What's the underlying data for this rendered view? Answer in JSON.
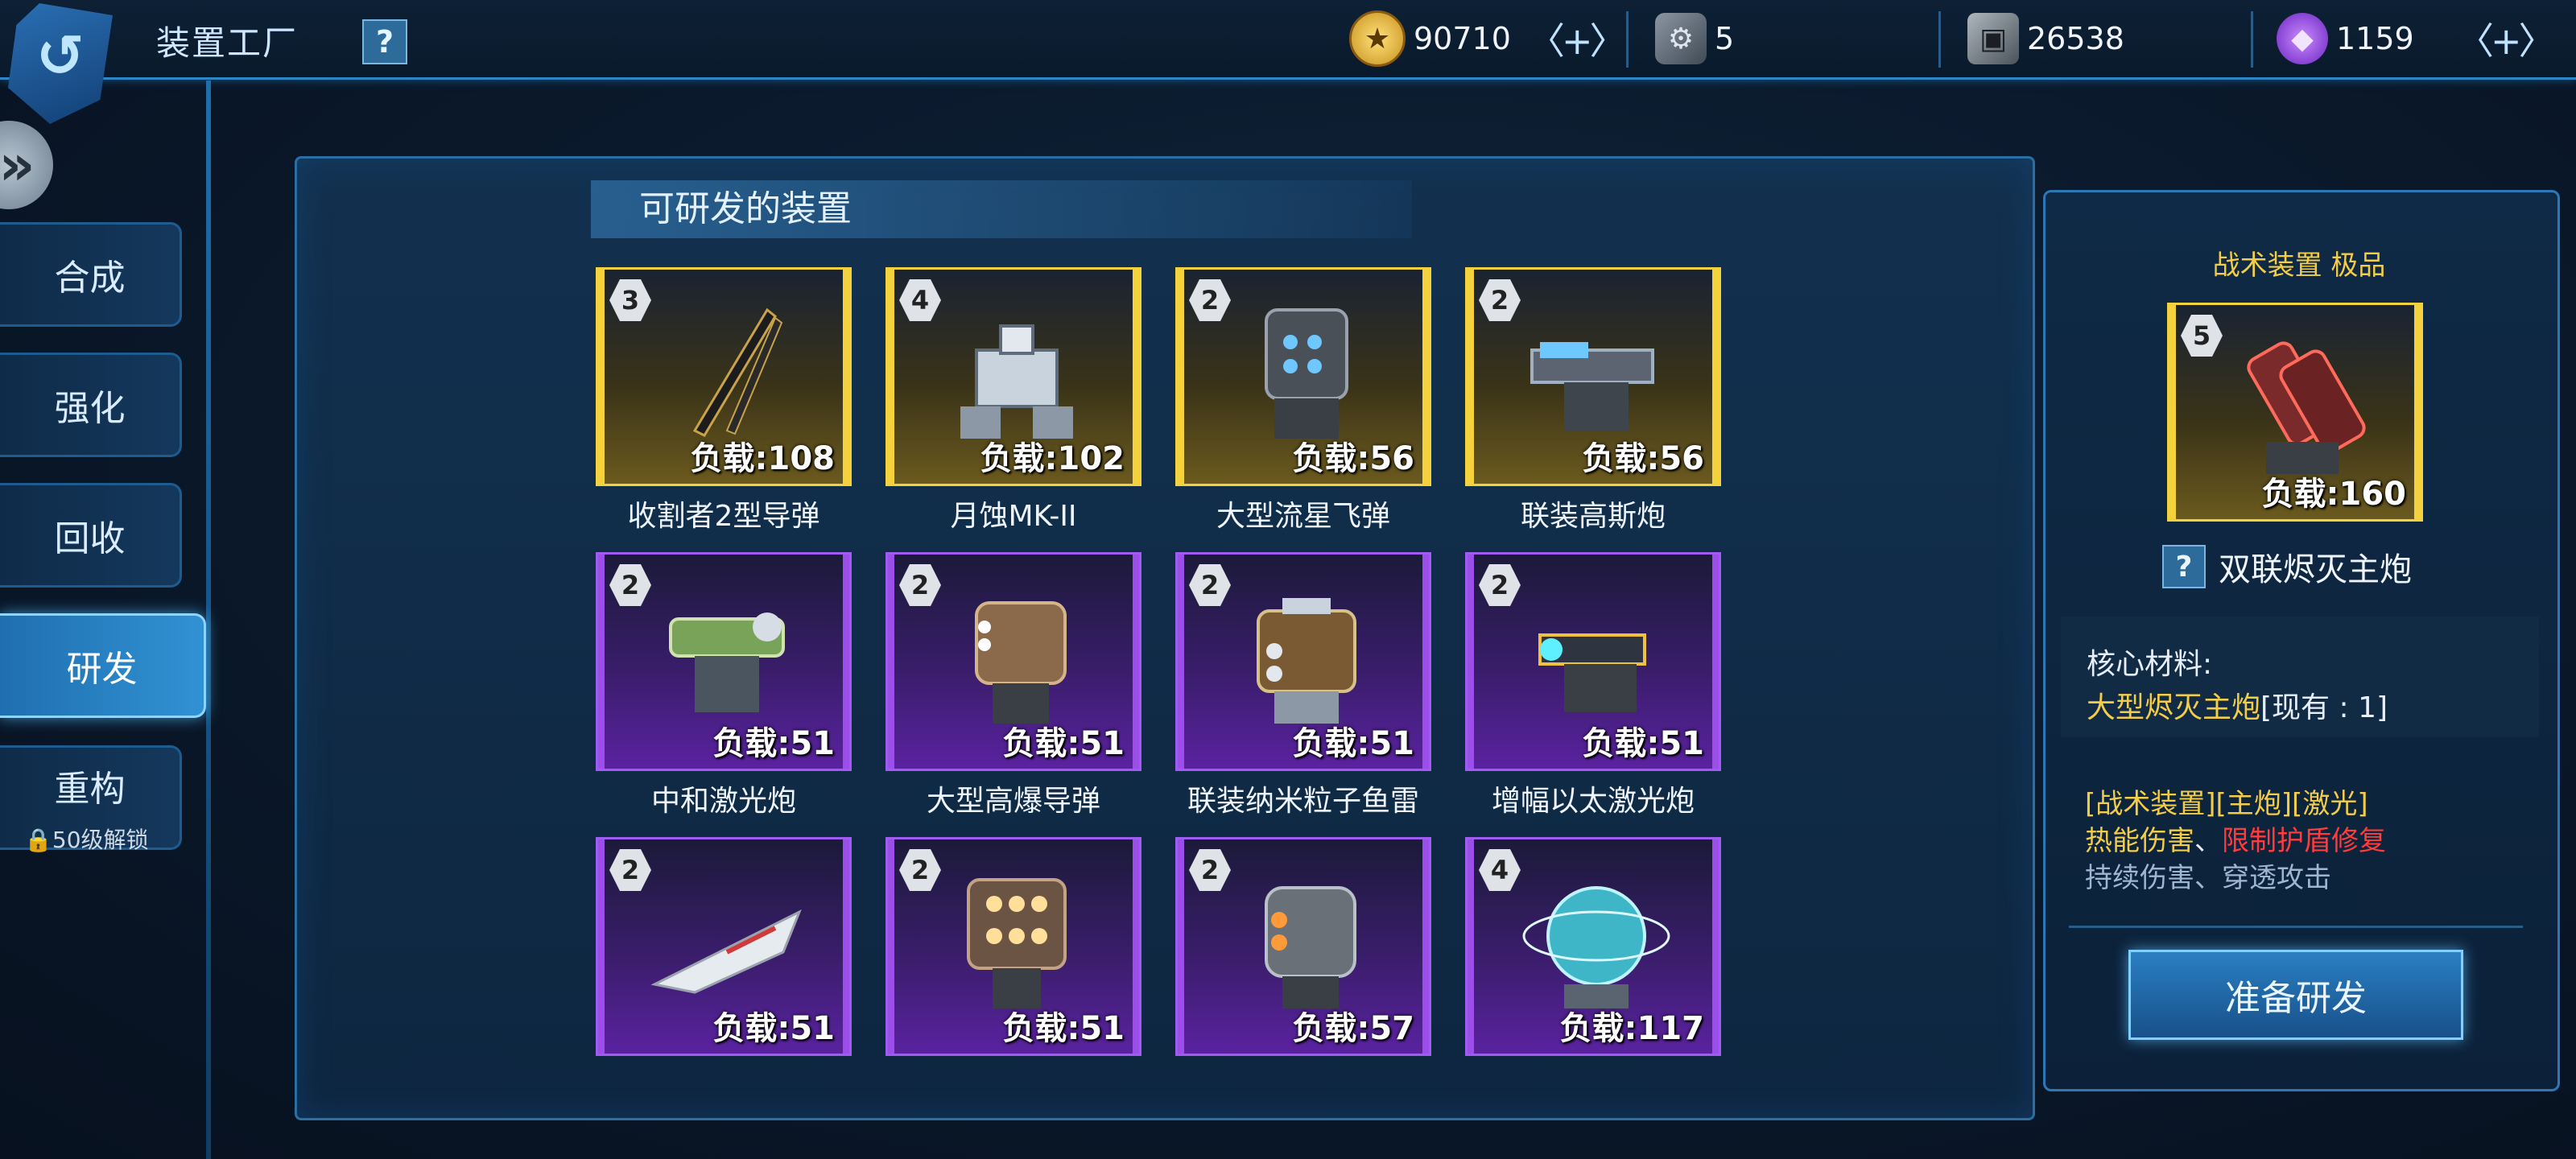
{
  "header": {
    "title": "装置工厂",
    "help_label": "?",
    "currencies": [
      {
        "icon": "gold-coin-icon",
        "value": "90710",
        "plus": "〈+〉"
      },
      {
        "icon": "mech-part-icon",
        "value": "5"
      },
      {
        "icon": "alloy-cube-icon",
        "value": "26538"
      },
      {
        "icon": "purple-crystal-icon",
        "value": "1159",
        "plus": "〈+〉"
      }
    ]
  },
  "nav": {
    "items": [
      {
        "label": "合成"
      },
      {
        "label": "强化"
      },
      {
        "label": "回收"
      },
      {
        "label": "研发"
      },
      {
        "label": "重构"
      }
    ],
    "lock_note": "50级解锁"
  },
  "main": {
    "section_title": "可研发的装置",
    "cards": [
      {
        "level": "3",
        "load": "负载:108",
        "name": "收割者2型导弹",
        "rarity": "gold"
      },
      {
        "level": "4",
        "load": "负载:102",
        "name": "月蚀MK-II",
        "rarity": "gold"
      },
      {
        "level": "2",
        "load": "负载:56",
        "name": "大型流星飞弹",
        "rarity": "gold"
      },
      {
        "level": "2",
        "load": "负载:56",
        "name": "联装高斯炮",
        "rarity": "gold"
      },
      {
        "level": "2",
        "load": "负载:51",
        "name": "中和激光炮",
        "rarity": "purple"
      },
      {
        "level": "2",
        "load": "负载:51",
        "name": "大型高爆导弹",
        "rarity": "purple"
      },
      {
        "level": "2",
        "load": "负载:51",
        "name": "联装纳米粒子鱼雷",
        "rarity": "purple"
      },
      {
        "level": "2",
        "load": "负载:51",
        "name": "增幅以太激光炮",
        "rarity": "purple"
      },
      {
        "level": "2",
        "load": "负载:51",
        "name": "",
        "rarity": "purple"
      },
      {
        "level": "2",
        "load": "负载:51",
        "name": "",
        "rarity": "purple"
      },
      {
        "level": "2",
        "load": "负载:57",
        "name": "",
        "rarity": "purple"
      },
      {
        "level": "4",
        "load": "负载:117",
        "name": "",
        "rarity": "purple"
      }
    ]
  },
  "detail": {
    "category": "战术装置 极品",
    "level": "5",
    "load": "负载:160",
    "help_label": "?",
    "name": "双联烬灭主炮",
    "material_label": "核心材料:",
    "material_name": "大型烬灭主炮",
    "material_have": "[现有 : 1]",
    "tags_line": "[战术装置][主炮][激光]",
    "effect_a": "热能伤害",
    "sep_a": "、",
    "effect_b": "限制护盾修复",
    "effect_c": "持续伤害、穿透攻击",
    "button_label": "准备研发"
  },
  "colors": {
    "gold_text": "#f3cd4a",
    "red_text": "#ff3b3b",
    "blue_grey_text": "#9fb6d0",
    "accent": "#2a88c8"
  }
}
